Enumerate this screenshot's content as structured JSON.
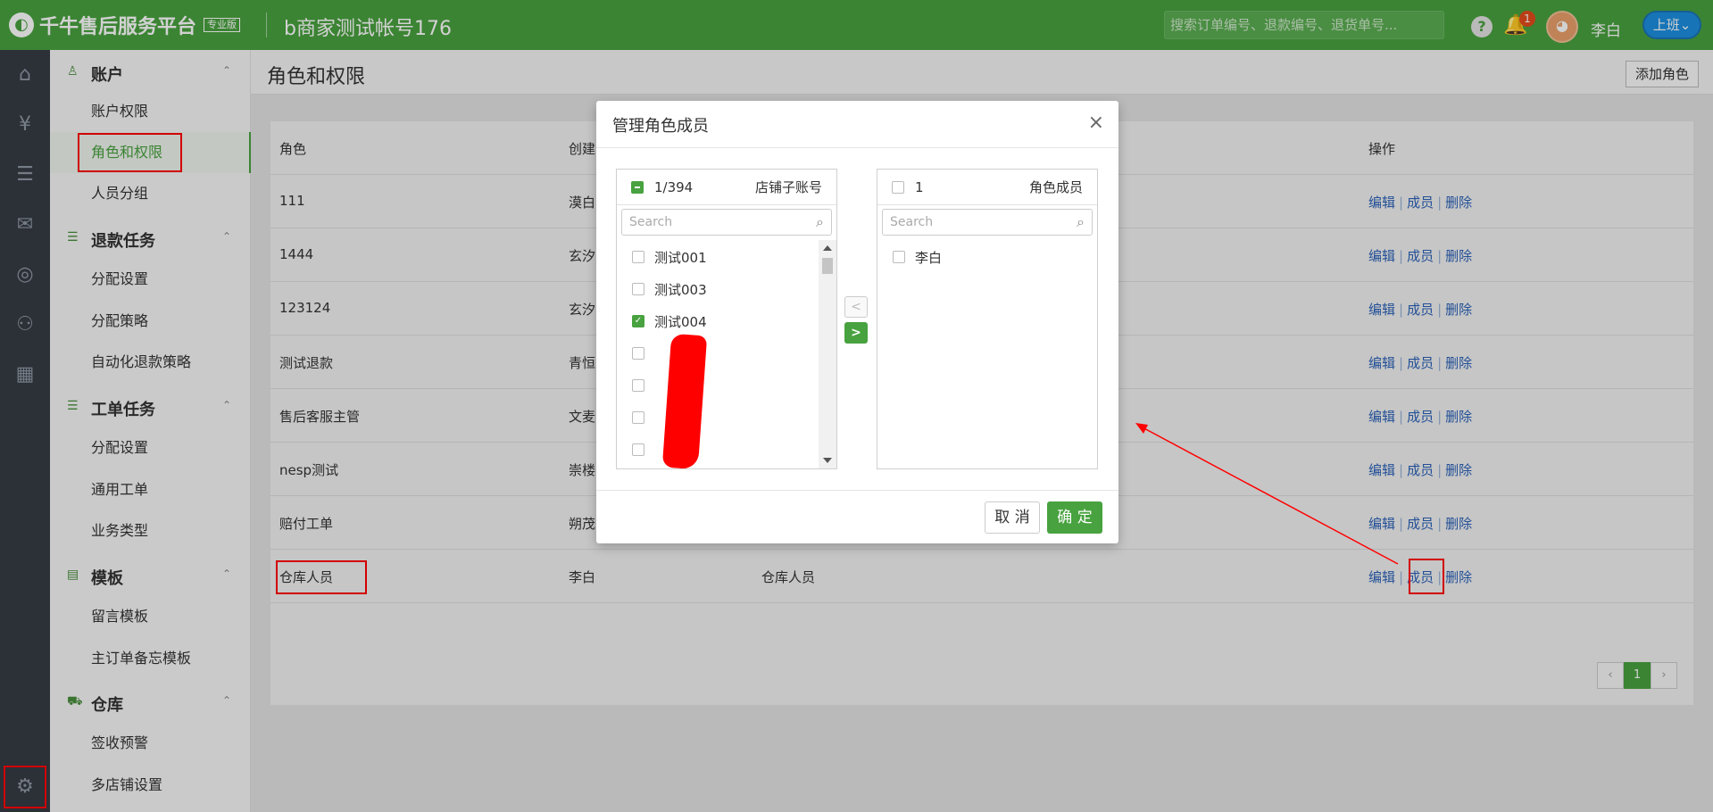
{
  "topbar": {
    "logo_glyph": "◐",
    "app_name": "千牛售后服务平台",
    "edition": "专业版",
    "account": "b商家测试帐号176",
    "search_placeholder": "搜索订单编号、退款编号、退货单号...",
    "help": "?",
    "notification_count": "1",
    "avatar": "◕",
    "user": "李白",
    "status_label": "上班⌄"
  },
  "rail_icons": [
    "home-icon",
    "money-icon",
    "list-icon",
    "chat-icon",
    "compass-icon",
    "users-icon",
    "calendar-icon",
    "gear-icon"
  ],
  "menu": {
    "groups": [
      {
        "icon": "♙",
        "label": "账户",
        "caret": "⌃",
        "items": [
          "账户权限",
          "角色和权限",
          "人员分组"
        ]
      },
      {
        "icon": "☰",
        "label": "退款任务",
        "caret": "⌃",
        "items": [
          "分配设置",
          "分配策略",
          "自动化退款策略"
        ]
      },
      {
        "icon": "☰",
        "label": "工单任务",
        "caret": "⌃",
        "items": [
          "分配设置",
          "通用工单",
          "业务类型"
        ]
      },
      {
        "icon": "▤",
        "label": "模板",
        "caret": "⌃",
        "items": [
          "留言模板",
          "主订单备忘模板"
        ]
      },
      {
        "icon": "⛟",
        "label": "仓库",
        "caret": "⌃",
        "items": [
          "签收预警",
          "多店铺设置"
        ]
      }
    ],
    "active_item": "角色和权限"
  },
  "page": {
    "title": "角色和权限",
    "add_role": "添加角色"
  },
  "table": {
    "columns": [
      "角色",
      "创建",
      "",
      "操作"
    ],
    "rows": [
      {
        "role": "111",
        "creator": "漠白",
        "desc": ""
      },
      {
        "role": "1444",
        "creator": "玄汐",
        "desc": ""
      },
      {
        "role": "123124",
        "creator": "玄汐",
        "desc": ""
      },
      {
        "role": "测试退款",
        "creator": "青恒",
        "desc": ""
      },
      {
        "role": "售后客服主管",
        "creator": "文麦",
        "desc": ""
      },
      {
        "role": "nesp测试",
        "creator": "崇楼",
        "desc": ""
      },
      {
        "role": "赔付工单",
        "creator": "朔茂",
        "desc": ""
      },
      {
        "role": "仓库人员",
        "creator": "李白",
        "desc": "仓库人员"
      }
    ],
    "ops": {
      "edit": "编辑",
      "members": "成员",
      "delete": "删除"
    },
    "pagination": {
      "prev": "‹",
      "current": "1",
      "next": "›"
    }
  },
  "modal": {
    "title": "管理角色成员",
    "close": "×",
    "left": {
      "count": "1/394",
      "title": "店铺子账号",
      "search_placeholder": "Search",
      "search_icon": "⌕",
      "items": [
        {
          "label": "测试001",
          "checked": false
        },
        {
          "label": "测试003",
          "checked": false
        },
        {
          "label": "测试004",
          "checked": true
        },
        {
          "label": "",
          "checked": false
        },
        {
          "label": "",
          "checked": false
        },
        {
          "label": "",
          "checked": false
        },
        {
          "label": "",
          "checked": false
        }
      ]
    },
    "right": {
      "count": "1",
      "title": "角色成员",
      "search_placeholder": "Search",
      "search_icon": "⌕",
      "items": [
        {
          "label": "李白",
          "checked": false
        }
      ]
    },
    "move_left": "<",
    "move_right": ">",
    "cancel": "取 消",
    "ok": "确 定",
    "check_glyph": "✓"
  },
  "colors": {
    "brand_green": "#48a23f",
    "link_blue": "#2b62b9",
    "annotation_red": "#ff0000"
  }
}
